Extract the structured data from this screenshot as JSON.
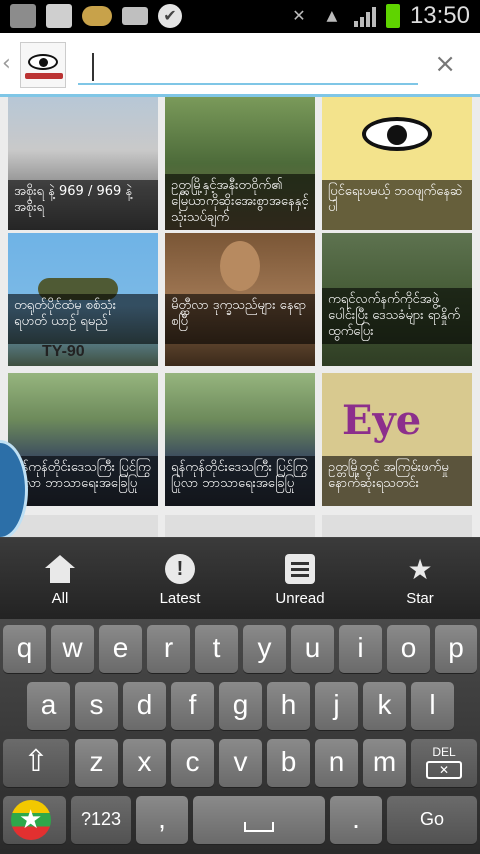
{
  "status_bar": {
    "time": "13:50",
    "icons": [
      "image-icon",
      "rss-icon",
      "coin-icon",
      "keyboard-icon",
      "check-icon",
      "mute-icon",
      "wifi-icon",
      "signal-icon",
      "battery-icon"
    ]
  },
  "header": {
    "search_value": "",
    "search_placeholder": "",
    "clear_symbol": "×",
    "back_symbol": "‹"
  },
  "grid": {
    "items": [
      {
        "caption": "အစိုးရ နဲ့ 969 / 969 နဲ့ အစိုးရ"
      },
      {
        "caption": "ဥတ္တမြို့နှင့်အနီးတဝိုက်၏ မြေယာကိုဆိုးအေးစွာအနေနှင့် သုံးသပ်ချက်"
      },
      {
        "caption": "ပြင်ရေးပမယ့် ဘဝဖျက်နေဆဲပါ"
      },
      {
        "caption": "တရုတ်ပိုင်ထံမှ စစ်သုံး ရဟတ် ယာဉ် ရမည်"
      },
      {
        "caption": "မိတ္ထီလာ ဒုက္ခသည်များ နေရာ စပြီ"
      },
      {
        "caption": "ကရင်လက်နက်ကိုင်အဖွဲ့ ပေါင်းပြီး ဒေသခံများ ရာနှိုက်ထွက်ပြေး"
      },
      {
        "caption": "ရန်ကုန်တိုင်းဒေသကြီး ပြင်ကြွပြုလာ ဘာသာရေးအခြေပြု"
      },
      {
        "caption": "ရန်ကုန်တိုင်းဒေသကြီး ပြင်ကြွပြုလာ ဘာသာရေးအခြေပြု"
      },
      {
        "caption": "ဥတ္တမြို့တွင် အကြမ်းဖက်မှု နောက်ဆုံးရသတင်း"
      }
    ],
    "tile_texts": {
      "helicopter_label": "TY-90",
      "eye_logo_text": "Eye"
    }
  },
  "tabbar": {
    "tabs": [
      {
        "label": "All",
        "icon": "home-icon"
      },
      {
        "label": "Latest",
        "icon": "alert-badge-icon"
      },
      {
        "label": "Unread",
        "icon": "document-icon"
      },
      {
        "label": "Star",
        "icon": "star-icon"
      }
    ]
  },
  "keyboard": {
    "row1": [
      "q",
      "w",
      "e",
      "r",
      "t",
      "y",
      "u",
      "i",
      "o",
      "p"
    ],
    "row2": [
      "a",
      "s",
      "d",
      "f",
      "g",
      "h",
      "j",
      "k",
      "l"
    ],
    "row3": [
      "z",
      "x",
      "c",
      "v",
      "b",
      "n",
      "m"
    ],
    "del_label": "DEL",
    "sym_label": "?123",
    "comma": ",",
    "period": ".",
    "go_label": "Go"
  }
}
